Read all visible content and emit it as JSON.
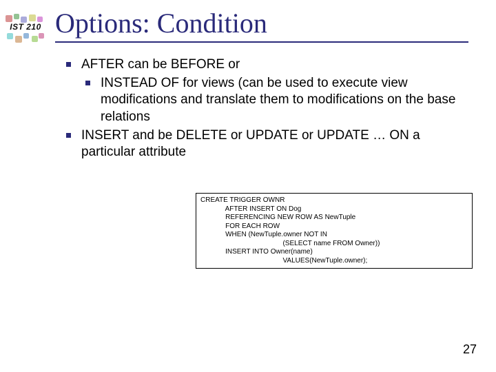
{
  "logo_label": "IST 210",
  "title": "Options: Condition",
  "bullets": {
    "b1": "AFTER can be BEFORE or",
    "b1a": "INSTEAD OF for views (can be used to execute view modifications and translate them to modifications on the base relations",
    "b2": "INSERT and be DELETE or UPDATE or UPDATE … ON a particular attribute"
  },
  "code": {
    "l1": "CREATE TRIGGER OWNR",
    "l2": "             AFTER INSERT ON Dog",
    "l3": "             REFERENCING NEW ROW AS NewTuple",
    "l4": "             FOR EACH ROW",
    "l5": "             WHEN (NewTuple.owner NOT IN",
    "l6": "                                           (SELECT name FROM Owner))",
    "l7": "             INSERT INTO Owner(name)",
    "l8": "                                           VALUES(NewTuple.owner);"
  },
  "page_number": "27"
}
